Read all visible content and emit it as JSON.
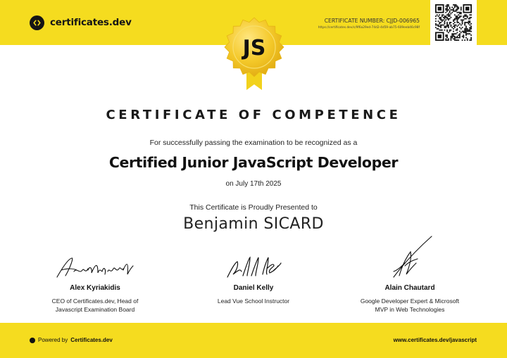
{
  "brand": {
    "name": "certificates.dev",
    "logo_icon": "code-brackets-icon"
  },
  "certificate": {
    "number_label": "CERTIFICATE NUMBER: CJJD-006965",
    "verify_url": "https://certificates.dev/c/9f6a29ed-74d2-4d59-ab75-609eeb46c98f",
    "badge_text": "JS",
    "heading": "CERTIFICATE OF COMPETENCE",
    "intro": "For successfully passing the examination to be recognized as a",
    "title": "Certified Junior JavaScript Developer",
    "date": "on July 17th 2025",
    "presented_text": "This Certificate is Proudly Presented to",
    "recipient": "Benjamin SICARD"
  },
  "signers": [
    {
      "name": "Alex Kyriakidis",
      "role_line1": "CEO of Certificates.dev, Head of",
      "role_line2": "Javascript Examination Board"
    },
    {
      "name": "Daniel Kelly",
      "role_line1": "Lead Vue School Instructor",
      "role_line2": ""
    },
    {
      "name": "Alain Chautard",
      "role_line1": "Google Developer Expert & Microsoft",
      "role_line2": "MVP in Web Technologies"
    }
  ],
  "footer": {
    "powered_prefix": "Powered by",
    "powered_brand": "Certificates.dev",
    "url": "www.certificates.dev/javascript"
  },
  "colors": {
    "band": "#f5dc1f",
    "badge_gold": "#f2c81e",
    "text_dark": "#151515"
  }
}
